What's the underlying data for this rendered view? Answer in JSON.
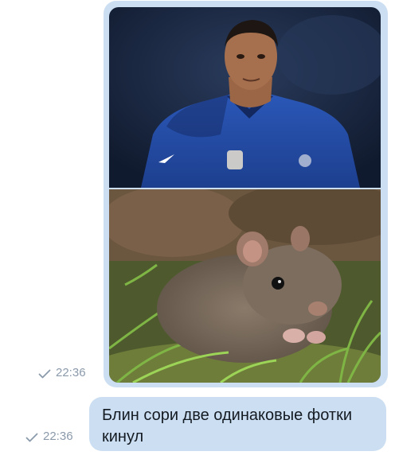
{
  "messages": [
    {
      "id": "photos",
      "time": "22:36",
      "status_icon": "check-icon",
      "photos": [
        {
          "subject": "footballer-portrait"
        },
        {
          "subject": "rat-photo"
        }
      ]
    },
    {
      "id": "text",
      "time": "22:36",
      "status_icon": "check-icon",
      "text": "Блин сори две одинаковые фотки кинул"
    }
  ],
  "colors": {
    "bubble": "#ccdff2",
    "meta": "#8b9aab",
    "text": "#141a22"
  }
}
